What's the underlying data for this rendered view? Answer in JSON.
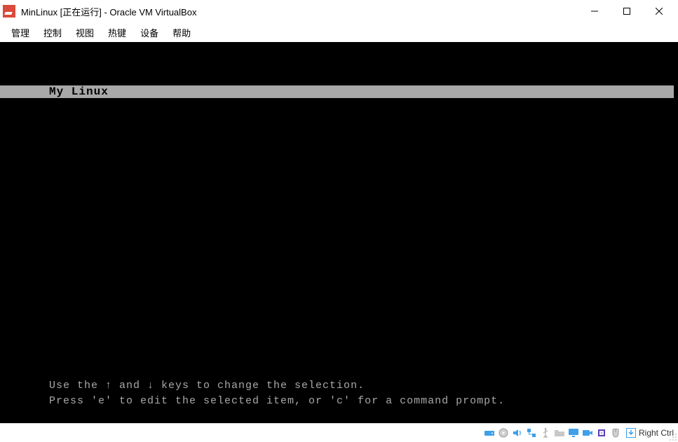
{
  "window": {
    "title": "MinLinux [正在运行] - Oracle VM VirtualBox"
  },
  "menubar": {
    "items": [
      "管理",
      "控制",
      "视图",
      "热键",
      "设备",
      "帮助"
    ]
  },
  "grub": {
    "selected_entry": "My Linux",
    "hint_line1": "Use the ↑ and ↓ keys to change the selection.",
    "hint_line2": "Press 'e' to edit the selected item, or 'c' for a command prompt."
  },
  "statusbar": {
    "hostkey_label": "Right Ctrl",
    "icons": {
      "hdd": "hdd-icon",
      "optical": "optical-icon",
      "audio": "audio-icon",
      "network": "network-icon",
      "usb": "usb-icon",
      "shared": "shared-folder-icon",
      "display": "display-icon",
      "recording": "recording-icon",
      "cpu": "cpu-icon",
      "mouse": "mouse-integration-icon"
    }
  },
  "colors": {
    "grub_highlight_bg": "#a8a8a8",
    "grub_text": "#a8a8a8",
    "vm_bg": "#000000"
  }
}
